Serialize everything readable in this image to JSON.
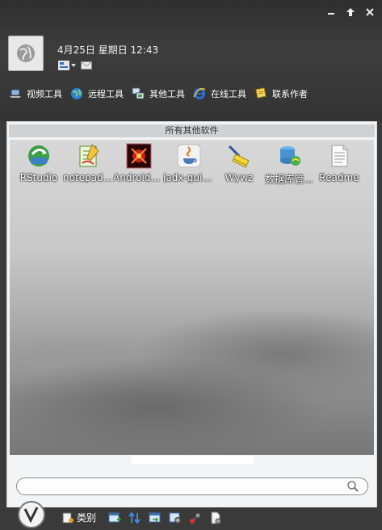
{
  "header": {
    "datetime": "4月25日 星期日 12:43"
  },
  "toolbar": {
    "tabs": [
      {
        "label": "视频工具",
        "icon": "laptop-icon"
      },
      {
        "label": "远程工具",
        "icon": "globe-icon"
      },
      {
        "label": "其他工具",
        "icon": "computer-icon"
      },
      {
        "label": "在线工具",
        "icon": "ie-icon"
      },
      {
        "label": "联系作者",
        "icon": "note-icon"
      }
    ]
  },
  "panel": {
    "title": "所有其他软件",
    "apps": [
      {
        "label": "RStudio",
        "icon": "rstudio-icon"
      },
      {
        "label": "notepad++",
        "icon": "notepad-icon"
      },
      {
        "label": "AndroidKi...",
        "icon": "android-killer-icon"
      },
      {
        "label": "jadx-gui-...",
        "icon": "java-icon"
      },
      {
        "label": "Wywz",
        "icon": "wywz-icon"
      },
      {
        "label": "数据库管...",
        "icon": "database-icon"
      },
      {
        "label": "Readme",
        "icon": "document-icon"
      }
    ]
  },
  "search": {
    "placeholder": "",
    "value": ""
  },
  "bottom": {
    "category_label": "类别"
  },
  "colors": {
    "background": "#3b3b3b",
    "panel": "#f2f4f6",
    "title_bar": "#cfd2d5"
  }
}
